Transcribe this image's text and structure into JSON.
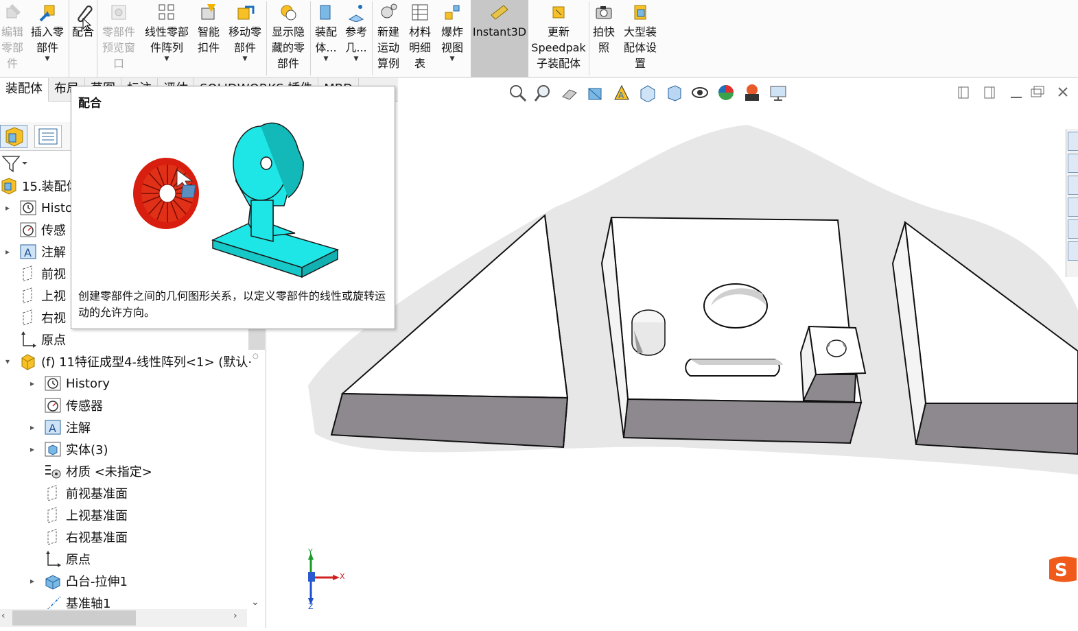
{
  "ribbon": {
    "buttons": [
      {
        "id": "edit-component",
        "label": "编辑\n零部\n件",
        "dim": true
      },
      {
        "id": "insert-component",
        "label": "插入零\n部件",
        "dropdown": true
      },
      {
        "id": "mate",
        "label": "配合",
        "selected": false
      },
      {
        "id": "component-preview",
        "label": "零部件\n预览窗\n口",
        "dim": true
      },
      {
        "id": "linear-pattern",
        "label": "线性零部\n件阵列",
        "dropdown": true
      },
      {
        "id": "smart-fasteners",
        "label": "智能\n扣件"
      },
      {
        "id": "move-component",
        "label": "移动零\n部件",
        "dropdown": true
      },
      {
        "id": "show-hidden",
        "label": "显示隐\n藏的零\n部件"
      },
      {
        "id": "assembly-features",
        "label": "装配\n体...",
        "dropdown": true
      },
      {
        "id": "reference-geometry",
        "label": "参考\n几...",
        "dropdown": true
      },
      {
        "id": "new-motion-study",
        "label": "新建\n运动\n算例"
      },
      {
        "id": "bom",
        "label": "材料\n明细\n表"
      },
      {
        "id": "exploded-view",
        "label": "爆炸\n视图",
        "dropdown": true
      },
      {
        "id": "instant3d",
        "label": "Instant3D",
        "selected": true
      },
      {
        "id": "update-speedpak",
        "label": "更新\nSpeedpak\n子装配体"
      },
      {
        "id": "snapshot",
        "label": "拍快\n照"
      },
      {
        "id": "large-assembly",
        "label": "大型装\n配体设\n置"
      }
    ]
  },
  "command_tabs": [
    "装配体",
    "布局",
    "草图",
    "标注",
    "评估",
    "SOLIDWORKS 插件",
    "MBD"
  ],
  "tooltip": {
    "title": "配合",
    "description": "创建零部件之间的几何图形关系，以定义零部件的线性或旋转运动的允许方向。"
  },
  "tree": {
    "root": "15.装配体",
    "items": [
      {
        "label": "Histo",
        "indent": 0,
        "arrow": "▸",
        "icon": "history-icon"
      },
      {
        "label": "传感",
        "indent": 0,
        "arrow": "",
        "icon": "sensor-icon"
      },
      {
        "label": "注解",
        "indent": 0,
        "arrow": "▸",
        "icon": "annotation-icon"
      },
      {
        "label": "前视",
        "indent": 0,
        "arrow": "",
        "icon": "plane-icon"
      },
      {
        "label": "上视",
        "indent": 0,
        "arrow": "",
        "icon": "plane-icon"
      },
      {
        "label": "右视",
        "indent": 0,
        "arrow": "",
        "icon": "plane-icon"
      },
      {
        "label": "原点",
        "indent": 0,
        "arrow": "",
        "icon": "origin-icon"
      },
      {
        "label": "(f) 11特征成型4-线性阵列<1> (默认·",
        "indent": 0,
        "arrow": "▾",
        "icon": "part-icon"
      },
      {
        "label": "History",
        "indent": 1,
        "arrow": "▸",
        "icon": "history-icon"
      },
      {
        "label": "传感器",
        "indent": 1,
        "arrow": "",
        "icon": "sensor-icon"
      },
      {
        "label": "注解",
        "indent": 1,
        "arrow": "▸",
        "icon": "annotation-icon"
      },
      {
        "label": "实体(3)",
        "indent": 1,
        "arrow": "▸",
        "icon": "solid-bodies-icon"
      },
      {
        "label": "材质 <未指定>",
        "indent": 1,
        "arrow": "",
        "icon": "material-icon"
      },
      {
        "label": "前视基准面",
        "indent": 1,
        "arrow": "",
        "icon": "plane-icon"
      },
      {
        "label": "上视基准面",
        "indent": 1,
        "arrow": "",
        "icon": "plane-icon"
      },
      {
        "label": "右视基准面",
        "indent": 1,
        "arrow": "",
        "icon": "plane-icon"
      },
      {
        "label": "原点",
        "indent": 1,
        "arrow": "",
        "icon": "origin-icon"
      },
      {
        "label": "凸台-拉伸1",
        "indent": 1,
        "arrow": "▸",
        "icon": "extrude-icon"
      },
      {
        "label": "基准轴1",
        "indent": 1,
        "arrow": "",
        "icon": "axis-icon"
      }
    ]
  },
  "triad": {
    "x": "X",
    "y": "Y",
    "z": "Z"
  },
  "colors": {
    "accent": "#1e73be",
    "tooltip_part": "#19e5e5",
    "selected_mate": "#e02010",
    "body_side": "#8c8c8c"
  }
}
